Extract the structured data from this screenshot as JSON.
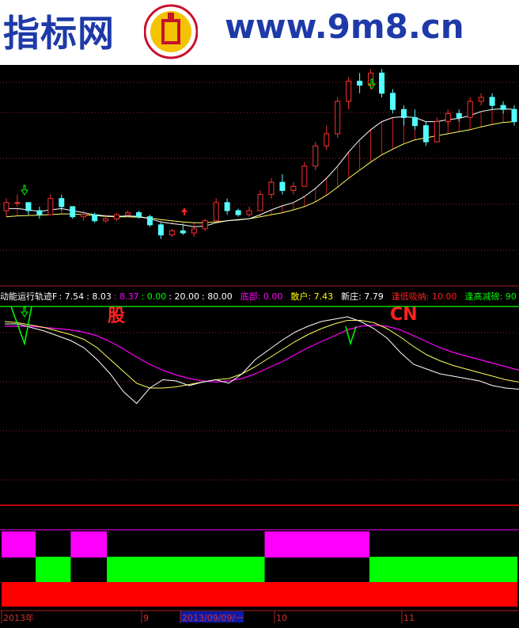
{
  "banner": {
    "left_text": "指标网",
    "right_text": "www.9m8.cn"
  },
  "indicator_header": {
    "name": "动能运行轨迹F",
    "params": [
      {
        "text": ": 7.54",
        "color": "#ffffff"
      },
      {
        "text": ": 8.03",
        "color": "#ffffff"
      },
      {
        "text": ": 8.37",
        "color": "#ff00ff"
      },
      {
        "text": ": 0.00",
        "color": "#00ff00"
      },
      {
        "text": ": 20.00",
        "color": "#ffffff"
      },
      {
        "text": ": 80.00",
        "color": "#ffffff"
      }
    ],
    "items": [
      {
        "label": "底部",
        "value": ": 0.00",
        "color": "#ff00ff"
      },
      {
        "label": "散户",
        "value": ": 7.43",
        "color": "#ffff00"
      },
      {
        "label": "新庄",
        "value": ": 7.79",
        "color": "#ffffff"
      },
      {
        "label": "逢低吸纳",
        "value": ": 10.00",
        "color": "#ff2020"
      },
      {
        "label": "逢高减磅",
        "value": ": 90",
        "color": "#00ff00"
      }
    ]
  },
  "watermarks": {
    "left": "股",
    "right": "CN"
  },
  "time_axis": {
    "labels": [
      "2013年",
      "9",
      "2013/09/09/一",
      "10",
      "11"
    ]
  },
  "colors": {
    "up": "#ff3030",
    "down": "#54ffff",
    "ma_white": "#ffffff",
    "ma_yellow": "#ffff60",
    "magenta": "#ff00ff",
    "green": "#00ff00",
    "red": "#ff0000",
    "grid": "#aa2222"
  },
  "chart_data": {
    "type": "line",
    "candles": [
      [
        7.1,
        7.4,
        7.0,
        7.3
      ],
      [
        7.3,
        7.5,
        7.2,
        7.3
      ],
      [
        7.3,
        7.3,
        7.0,
        7.1
      ],
      [
        7.1,
        7.2,
        6.9,
        7.0
      ],
      [
        7.0,
        7.5,
        7.0,
        7.4
      ],
      [
        7.4,
        7.5,
        7.1,
        7.2
      ],
      [
        7.2,
        7.2,
        6.9,
        6.95
      ],
      [
        6.95,
        7.1,
        6.85,
        7.0
      ],
      [
        7.0,
        7.05,
        6.8,
        6.85
      ],
      [
        6.85,
        7.0,
        6.8,
        6.9
      ],
      [
        6.9,
        7.05,
        6.85,
        7.0
      ],
      [
        7.0,
        7.1,
        6.95,
        7.05
      ],
      [
        7.05,
        7.1,
        6.9,
        6.95
      ],
      [
        6.95,
        7.0,
        6.7,
        6.75
      ],
      [
        6.75,
        6.8,
        6.4,
        6.5
      ],
      [
        6.5,
        6.65,
        6.45,
        6.6
      ],
      [
        6.6,
        6.75,
        6.5,
        6.55
      ],
      [
        6.55,
        6.7,
        6.45,
        6.65
      ],
      [
        6.65,
        6.9,
        6.6,
        6.85
      ],
      [
        6.85,
        7.4,
        6.85,
        7.3
      ],
      [
        7.3,
        7.4,
        7.0,
        7.1
      ],
      [
        7.1,
        7.15,
        6.95,
        7.0
      ],
      [
        7.0,
        7.2,
        6.95,
        7.1
      ],
      [
        7.1,
        7.6,
        7.1,
        7.5
      ],
      [
        7.5,
        7.9,
        7.4,
        7.8
      ],
      [
        7.8,
        8.0,
        7.5,
        7.6
      ],
      [
        7.6,
        7.8,
        7.5,
        7.7
      ],
      [
        7.7,
        8.3,
        7.7,
        8.2
      ],
      [
        8.2,
        8.8,
        8.1,
        8.7
      ],
      [
        8.7,
        9.2,
        8.6,
        9.0
      ],
      [
        9.0,
        9.9,
        8.9,
        9.8
      ],
      [
        9.8,
        10.4,
        9.6,
        10.3
      ],
      [
        10.3,
        10.5,
        10.0,
        10.2
      ],
      [
        10.2,
        10.6,
        10.1,
        10.5
      ],
      [
        10.5,
        10.6,
        9.9,
        10.0
      ],
      [
        10.0,
        10.1,
        9.5,
        9.6
      ],
      [
        9.6,
        9.7,
        9.2,
        9.4
      ],
      [
        9.4,
        9.6,
        9.1,
        9.2
      ],
      [
        9.2,
        9.3,
        8.7,
        8.8
      ],
      [
        8.8,
        9.4,
        8.8,
        9.3
      ],
      [
        9.3,
        9.6,
        9.2,
        9.5
      ],
      [
        9.5,
        9.6,
        9.3,
        9.4
      ],
      [
        9.4,
        9.9,
        9.4,
        9.8
      ],
      [
        9.8,
        10.0,
        9.7,
        9.9
      ],
      [
        9.9,
        10.0,
        9.6,
        9.7
      ],
      [
        9.7,
        9.8,
        9.5,
        9.6
      ],
      [
        9.6,
        9.7,
        9.2,
        9.3
      ]
    ],
    "ma_white": [
      7.15,
      7.15,
      7.12,
      7.08,
      7.12,
      7.15,
      7.1,
      7.05,
      7.0,
      6.97,
      6.96,
      6.97,
      6.96,
      6.9,
      6.82,
      6.78,
      6.75,
      6.7,
      6.72,
      6.8,
      6.85,
      6.88,
      6.9,
      7.0,
      7.12,
      7.22,
      7.3,
      7.45,
      7.65,
      7.9,
      8.2,
      8.55,
      8.85,
      9.1,
      9.3,
      9.4,
      9.42,
      9.4,
      9.3,
      9.3,
      9.35,
      9.38,
      9.45,
      9.55,
      9.6,
      9.62,
      9.6
    ],
    "ma_yellow": [
      6.95,
      6.97,
      6.98,
      6.99,
      7.0,
      7.02,
      7.02,
      7.0,
      6.98,
      6.96,
      6.95,
      6.95,
      6.94,
      6.92,
      6.88,
      6.85,
      6.82,
      6.8,
      6.8,
      6.82,
      6.85,
      6.87,
      6.9,
      6.95,
      7.0,
      7.05,
      7.12,
      7.2,
      7.32,
      7.48,
      7.68,
      7.9,
      8.1,
      8.3,
      8.48,
      8.62,
      8.75,
      8.85,
      8.9,
      8.95,
      9.0,
      9.05,
      9.1,
      9.17,
      9.23,
      9.28,
      9.3
    ],
    "ind_white": [
      82,
      82,
      79,
      76,
      72,
      68,
      62,
      52,
      40,
      25,
      15,
      28,
      35,
      34,
      30,
      33,
      35,
      32,
      40,
      52,
      60,
      68,
      75,
      80,
      84,
      86,
      88,
      84,
      78,
      70,
      58,
      48,
      44,
      40,
      38,
      36,
      34,
      30,
      28,
      27
    ],
    "ind_yellow": [
      84,
      83,
      81,
      79,
      76,
      73,
      69,
      62,
      52,
      42,
      32,
      28,
      28,
      29,
      31,
      33,
      35,
      36,
      40,
      46,
      53,
      60,
      67,
      73,
      78,
      82,
      85,
      85,
      83,
      78,
      71,
      63,
      56,
      51,
      47,
      44,
      41,
      38,
      35,
      33
    ],
    "ind_magenta": [
      80,
      80,
      80,
      79,
      78,
      77,
      75,
      72,
      67,
      61,
      54,
      48,
      43,
      39,
      36,
      34,
      33,
      34,
      36,
      40,
      45,
      50,
      56,
      62,
      67,
      72,
      77,
      80,
      81,
      80,
      77,
      72,
      67,
      62,
      58,
      55,
      52,
      49,
      46,
      43
    ],
    "bar_magenta_segments": [
      [
        0,
        0.066
      ],
      [
        0.134,
        0.204
      ],
      [
        0.51,
        0.713
      ]
    ],
    "bar_green_segments": [
      [
        0.066,
        0.134
      ],
      [
        0.204,
        0.51
      ],
      [
        0.713,
        1.0
      ]
    ]
  }
}
